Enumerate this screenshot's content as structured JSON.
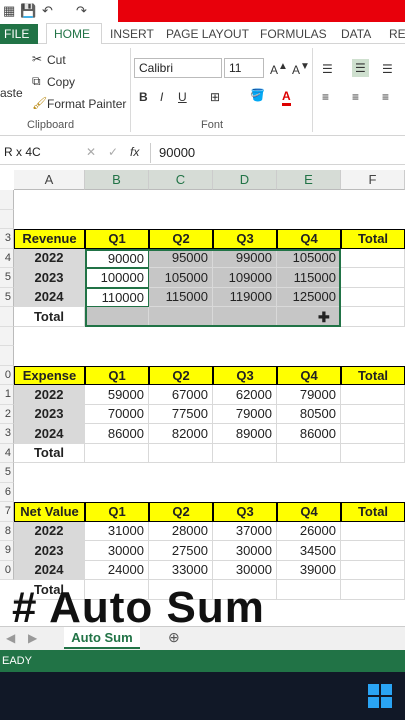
{
  "tabs": {
    "file": "FILE",
    "home": "HOME",
    "insert": "INSERT",
    "page_layout": "PAGE LAYOUT",
    "formulas": "FORMULAS",
    "data": "DATA",
    "review": "REV"
  },
  "clipboard": {
    "paste": "aste",
    "cut": "Cut",
    "copy": "Copy",
    "format_painter": "Format Painter",
    "label": "Clipboard"
  },
  "font": {
    "name": "Calibri",
    "size": "11",
    "label": "Font",
    "bold": "B",
    "italic": "I",
    "underline": "U"
  },
  "formula_bar": {
    "name_box": "R x 4C",
    "fx": "fx",
    "value": "90000"
  },
  "columns": [
    "A",
    "B",
    "C",
    "D",
    "E",
    "F"
  ],
  "rows": [
    "",
    "",
    "3",
    "4",
    "5",
    "5",
    "",
    "",
    "",
    "0",
    "1",
    "2",
    "3",
    "4",
    "5",
    "6",
    "7",
    "8",
    "9",
    "0"
  ],
  "tables": [
    {
      "title": "Revenue",
      "headers": [
        "Q1",
        "Q2",
        "Q3",
        "Q4",
        "Total"
      ],
      "rows": [
        [
          "2022",
          "90000",
          "95000",
          "99000",
          "105000"
        ],
        [
          "2023",
          "100000",
          "105000",
          "109000",
          "115000"
        ],
        [
          "2024",
          "110000",
          "115000",
          "119000",
          "125000"
        ]
      ],
      "total_label": "Total"
    },
    {
      "title": "Expense",
      "headers": [
        "Q1",
        "Q2",
        "Q3",
        "Q4",
        "Total"
      ],
      "rows": [
        [
          "2022",
          "59000",
          "67000",
          "62000",
          "79000"
        ],
        [
          "2023",
          "70000",
          "77500",
          "79000",
          "80500"
        ],
        [
          "2024",
          "86000",
          "82000",
          "89000",
          "86000"
        ]
      ],
      "total_label": "Total"
    },
    {
      "title": "Net Value",
      "headers": [
        "Q1",
        "Q2",
        "Q3",
        "Q4",
        "Total"
      ],
      "rows": [
        [
          "2022",
          "31000",
          "28000",
          "37000",
          "26000"
        ],
        [
          "2023",
          "30000",
          "27500",
          "30000",
          "34500"
        ],
        [
          "2024",
          "24000",
          "33000",
          "30000",
          "39000"
        ]
      ],
      "total_label": "Total"
    }
  ],
  "caption": "# Auto Sum",
  "sheet_tab": "Auto Sum",
  "status": "EADY",
  "colors": {
    "excel_green": "#217346",
    "header_yellow": "#ffff00",
    "red_banner": "#e8000b"
  }
}
